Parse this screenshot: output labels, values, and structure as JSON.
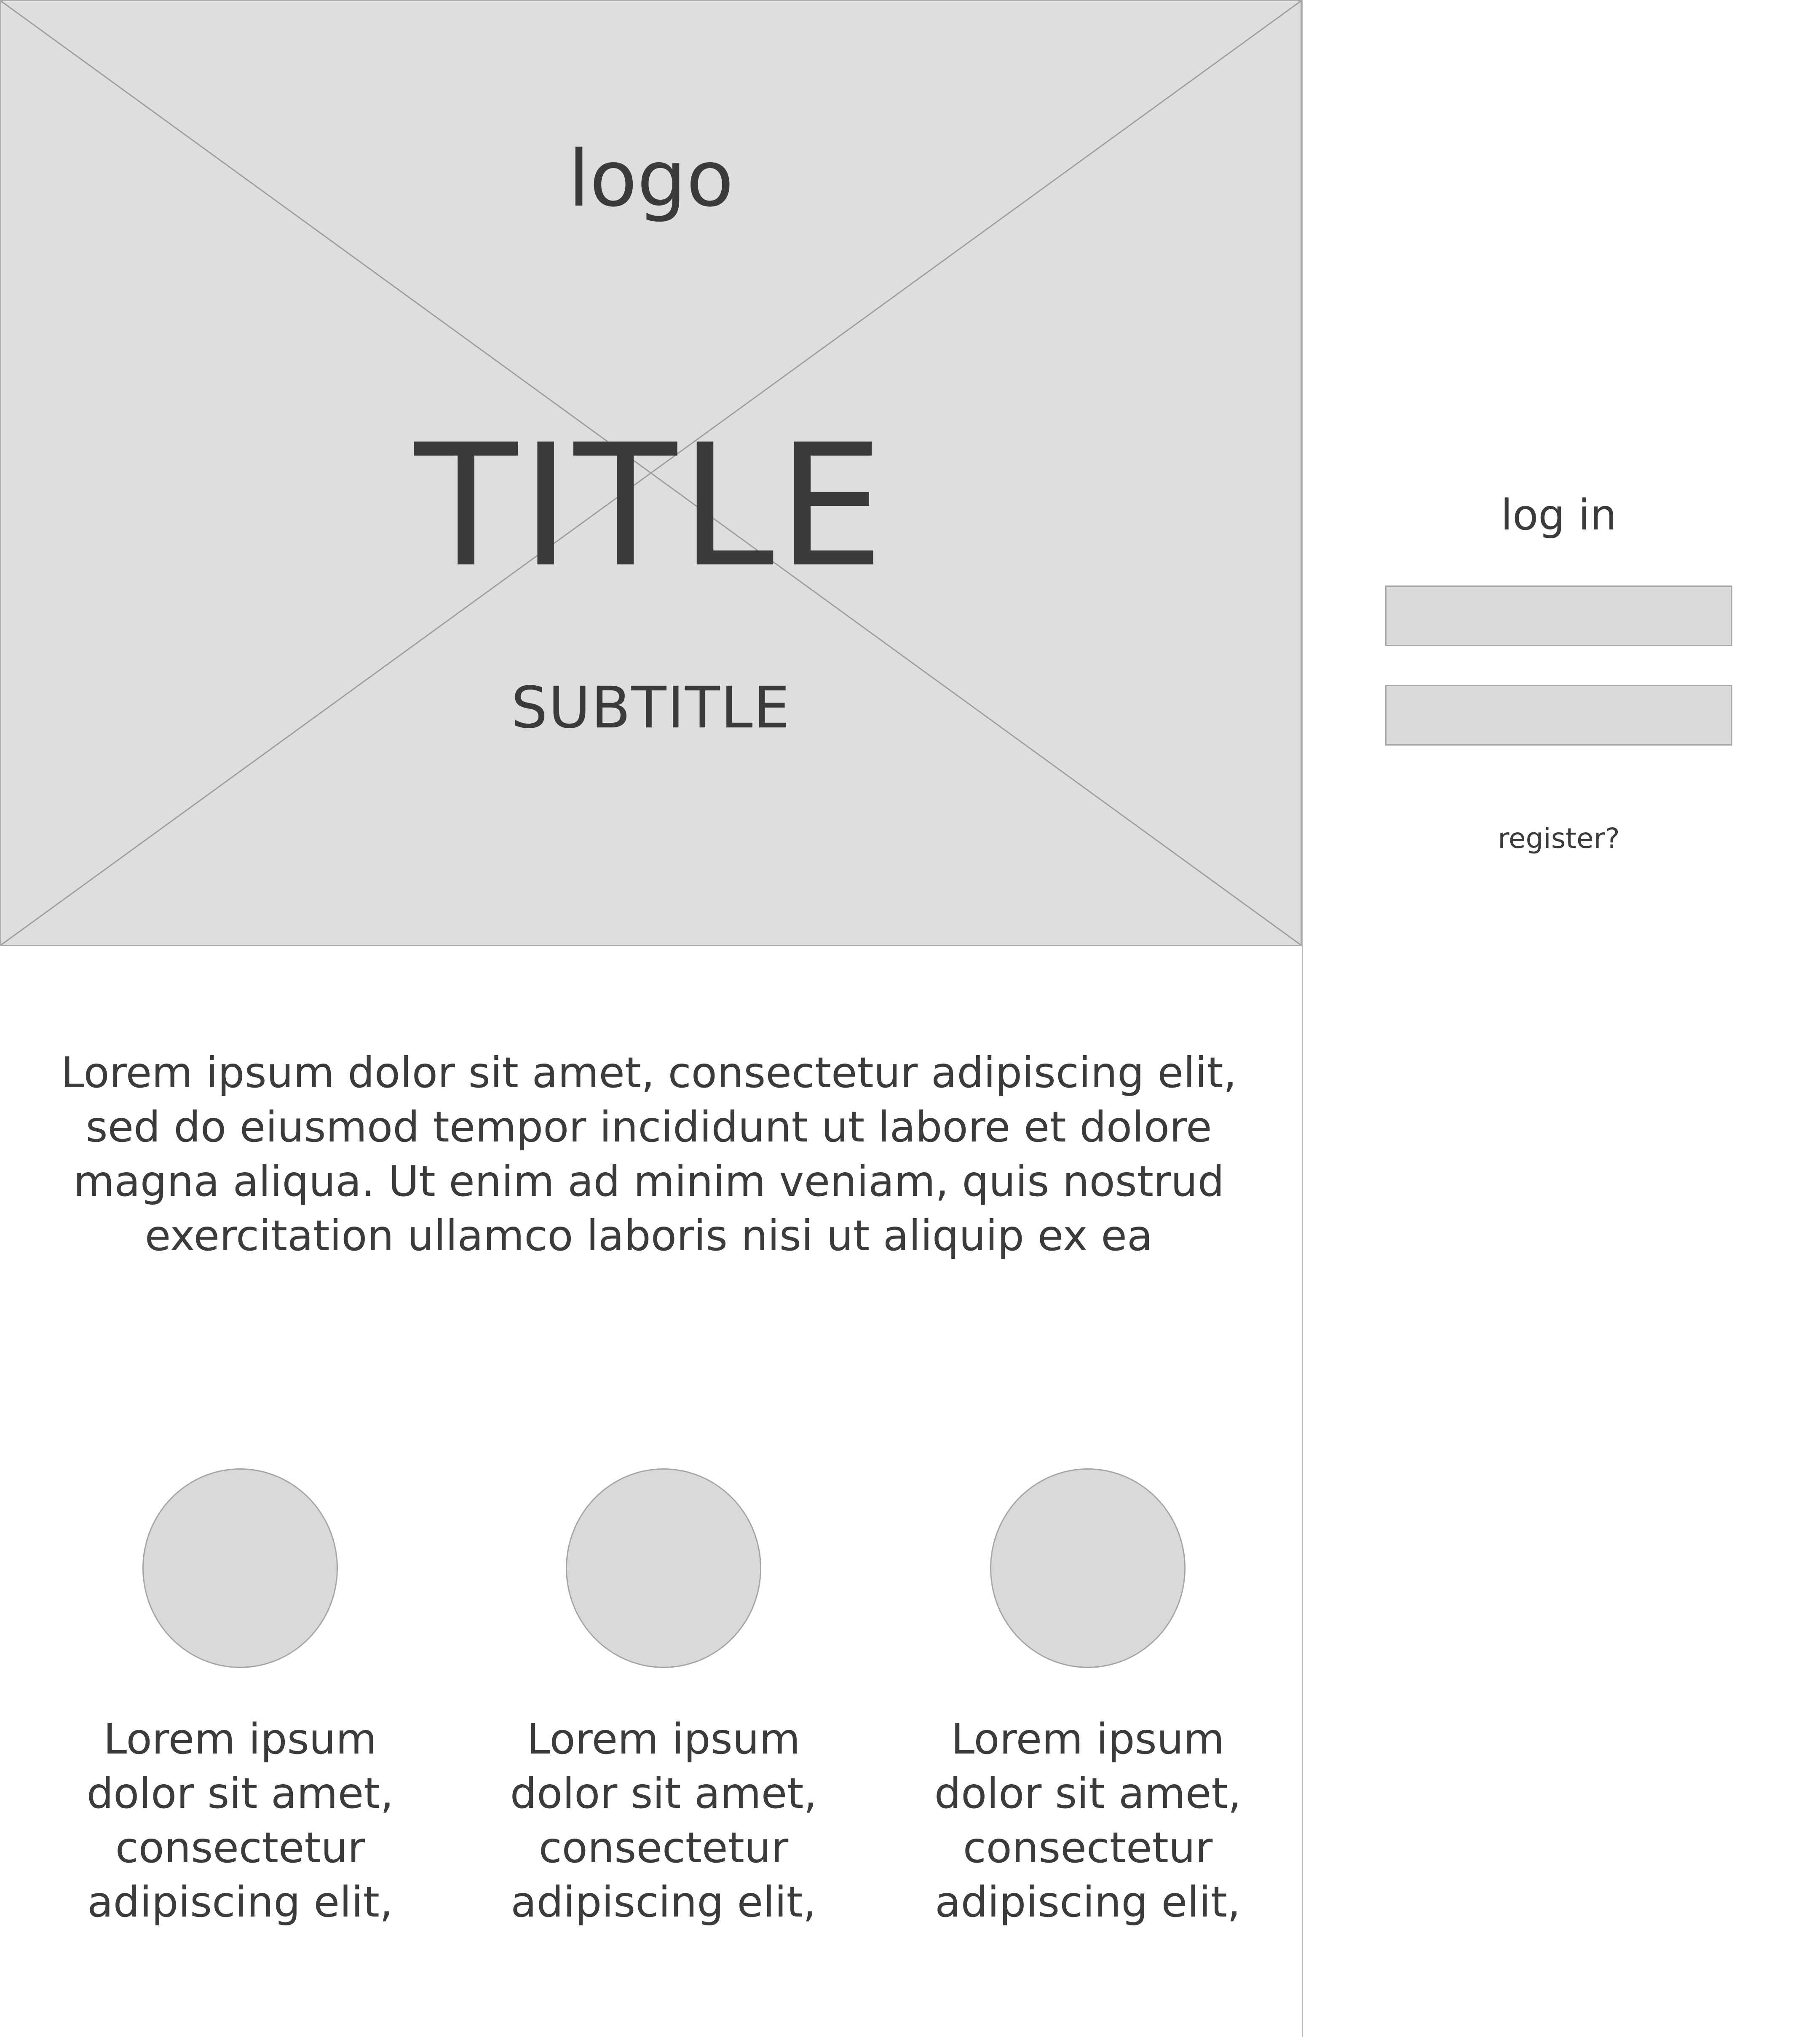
{
  "hero": {
    "logo": "logo",
    "title": "TITLE",
    "subtitle": "SUBTITLE"
  },
  "login": {
    "heading": "log in",
    "fields": [
      {
        "value": "",
        "placeholder": ""
      },
      {
        "value": "",
        "placeholder": ""
      }
    ],
    "register_label": "register?"
  },
  "intro": {
    "text": "Lorem ipsum dolor sit amet, consectetur adipiscing elit, sed do eiusmod tempor incididunt ut labore et dolore magna aliqua. Ut enim ad minim veniam, quis nostrud exercitation ullamco laboris nisi ut aliquip ex ea"
  },
  "features": [
    {
      "text": "Lorem ipsum dolor sit amet, consectetur adipiscing elit,"
    },
    {
      "text": "Lorem ipsum dolor sit amet, consectetur adipiscing elit,"
    },
    {
      "text": "Lorem ipsum dolor sit amet, consectetur adipiscing elit,"
    }
  ],
  "colors": {
    "placeholder_fill": "#dedede",
    "placeholder_stroke": "#a8a8a8",
    "text": "#3b3b3b"
  }
}
